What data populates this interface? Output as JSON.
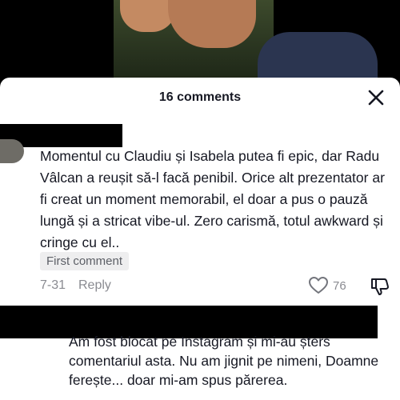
{
  "panel": {
    "title": "16 comments"
  },
  "icons": {
    "close": "close-icon",
    "like": "heart-outline-icon",
    "dislike": "thumbs-down-icon"
  },
  "comments": [
    {
      "text": "Momentul cu Claudiu și Isabela putea fi epic, dar Radu Vâlcan a reușit să-l facă penibil. Orice alt prezentator ar fi creat un moment memorabil, el doar a pus o pauză lungă și a stricat vibe-ul. Zero carismă, totul awkward și cringe cu el..",
      "badge": "First comment",
      "date": "7-31",
      "reply_label": "Reply",
      "likes": "76"
    },
    {
      "text": "Am fost blocat pe Instagram și mi-au șters comentariul asta. Nu am jignit pe nimeni, Doamne ferește... doar mi-am spus părerea."
    }
  ],
  "colors": {
    "sheet_bg": "#ffffff",
    "text_primary": "#161823",
    "text_secondary": "#8a8b91",
    "chip_bg": "#eeeeef",
    "redaction": "#000000"
  }
}
